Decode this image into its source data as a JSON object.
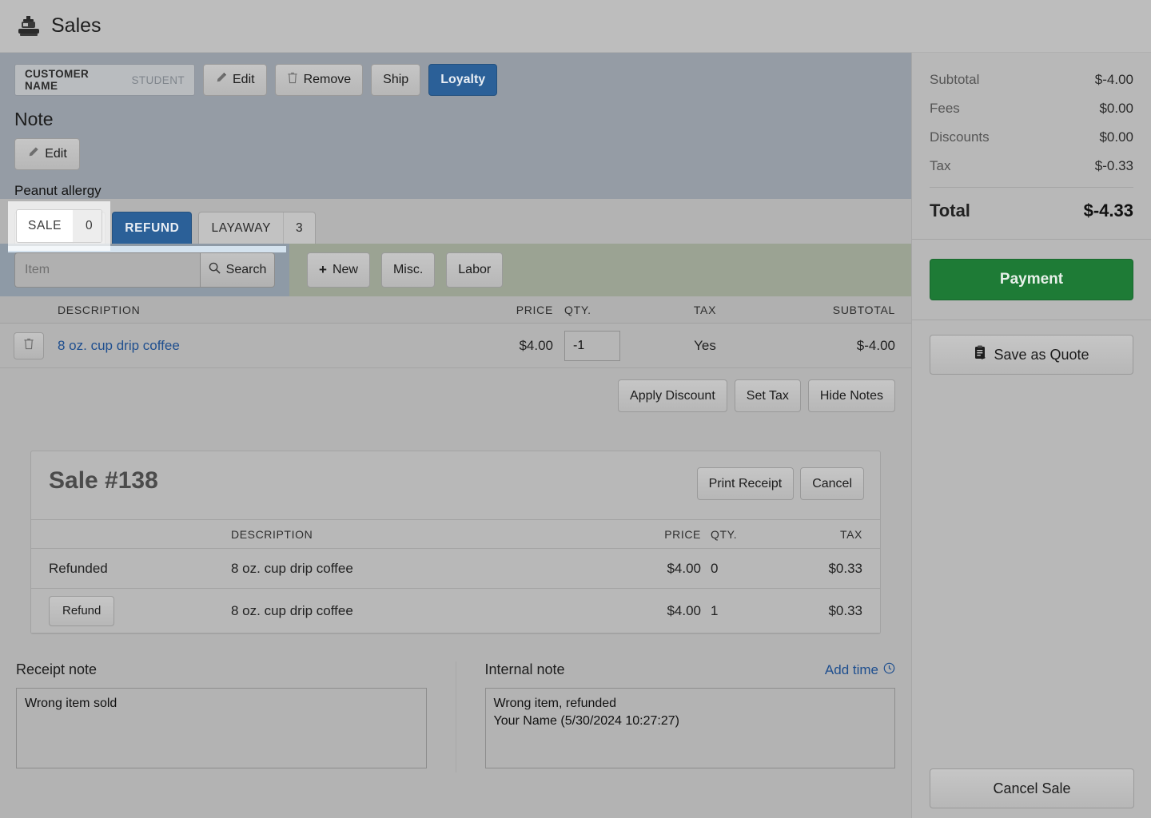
{
  "header": {
    "title": "Sales",
    "icon": "cash-register-icon"
  },
  "customer": {
    "name_label": "CUSTOMER NAME",
    "name_value": "STUDENT",
    "edit_label": "Edit",
    "remove_label": "Remove",
    "ship_label": "Ship",
    "loyalty_label": "Loyalty"
  },
  "note": {
    "heading": "Note",
    "edit_label": "Edit",
    "text": "Peanut allergy"
  },
  "tabs": [
    {
      "label": "SALE",
      "count": "0",
      "active": false
    },
    {
      "label": "REFUND",
      "count": "",
      "active": true
    },
    {
      "label": "LAYAWAY",
      "count": "3",
      "active": false
    }
  ],
  "search": {
    "placeholder": "Item",
    "value": "",
    "search_label": "Search",
    "new_label": "New",
    "misc_label": "Misc.",
    "labor_label": "Labor"
  },
  "items_table": {
    "columns": [
      "DESCRIPTION",
      "PRICE",
      "QTY.",
      "TAX",
      "SUBTOTAL"
    ],
    "rows": [
      {
        "description": "8 oz. cup drip coffee",
        "price": "$4.00",
        "qty": "-1",
        "tax": "Yes",
        "subtotal": "$-4.00"
      }
    ]
  },
  "item_actions": {
    "apply_discount": "Apply Discount",
    "set_tax": "Set Tax",
    "hide_notes": "Hide Notes"
  },
  "sale_panel": {
    "title": "Sale #138",
    "print_receipt": "Print Receipt",
    "cancel": "Cancel",
    "columns": [
      "",
      "DESCRIPTION",
      "PRICE",
      "QTY.",
      "TAX"
    ],
    "rows": [
      {
        "state": "Refunded",
        "state_is_button": false,
        "description": "8 oz. cup drip coffee",
        "price": "$4.00",
        "qty": "0",
        "tax": "$0.33"
      },
      {
        "state": "Refund",
        "state_is_button": true,
        "description": "8 oz. cup drip coffee",
        "price": "$4.00",
        "qty": "1",
        "tax": "$0.33"
      }
    ]
  },
  "notes_section": {
    "receipt_label": "Receipt note",
    "receipt_value": "Wrong item sold",
    "internal_label": "Internal note",
    "add_time_label": "Add time",
    "add_time_icon": "clock-icon",
    "internal_value": "Wrong item, refunded\nYour Name (5/30/2024 10:27:27)"
  },
  "sidebar": {
    "totals": [
      {
        "label": "Subtotal",
        "value": "$-4.00"
      },
      {
        "label": "Fees",
        "value": "$0.00"
      },
      {
        "label": "Discounts",
        "value": "$0.00"
      },
      {
        "label": "Tax",
        "value": "$-0.33"
      }
    ],
    "total_label": "Total",
    "total_value": "$-4.33",
    "payment_label": "Payment",
    "save_quote_label": "Save as Quote",
    "cancel_sale_label": "Cancel Sale"
  },
  "colors": {
    "accent_blue": "#2b6098",
    "payment_green": "#1e7b36",
    "link_blue": "#1f4f8f",
    "customer_band": "#959ca5",
    "search_band_left": "#8e9aa6",
    "search_band_right": "#9ba393",
    "page_bg": "#b3b3b3"
  }
}
